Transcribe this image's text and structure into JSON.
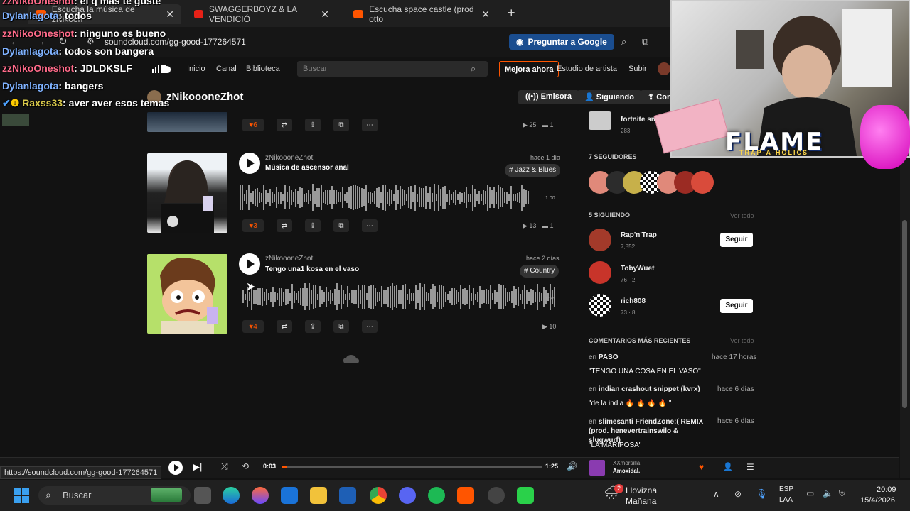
{
  "browser": {
    "tabs": [
      {
        "label": "Escucha la música de zNikoon"
      },
      {
        "label": "SWAGGERBOYZ & LA VENDICIÓ"
      },
      {
        "label": "Escucha space castle (prod otto"
      }
    ],
    "new_tab": "+",
    "url": "soundcloud.com/gg-good-177264571",
    "google_button": "Preguntar a Google"
  },
  "soundcloud": {
    "nav": {
      "home": "Inicio",
      "feed": "Canal",
      "library": "Biblioteca"
    },
    "search_placeholder": "Buscar",
    "upgrade": "Mejora ahora",
    "artist_studio": "Estudio de artista",
    "upload": "Subir",
    "profile_name": "zNikoooneZhot",
    "buttons": {
      "station": "Emisora",
      "following": "Siguiendo",
      "share": "Com"
    },
    "tracks": [
      {
        "likes": "6",
        "plays": "25",
        "comments": "1"
      },
      {
        "user": "zNikoooneZhot",
        "title": "Música de ascensor anal",
        "date": "hace 1 día",
        "tag": "# Jazz & Blues",
        "duration": "1:00",
        "likes": "3",
        "plays": "13",
        "comments": "1"
      },
      {
        "user": "zNikoooneZhot",
        "title": "Tengo una1 kosa en el vaso",
        "date": "hace 2 días",
        "tag": "# Country",
        "duration": "1:25",
        "likes": "4",
        "plays": "10"
      }
    ],
    "sidebar": {
      "top_user": {
        "name": "fortnite snip",
        "stats": "283"
      },
      "followers_title": "7 SEGUIDORES",
      "following_title": "5 SIGUIENDO",
      "view_all": "Ver todo",
      "following": [
        {
          "name": "Rap'n'Trap",
          "stats": "7,852",
          "button": "Seguir"
        },
        {
          "name": "TobyWuet",
          "stats": "76 · 2"
        },
        {
          "name": "rich808",
          "stats": "73 · 8",
          "button": "Seguir"
        }
      ],
      "comments_title": "COMENTARIOS MÁS RECIENTES",
      "comments": [
        {
          "prefix": "en",
          "track": "PASO",
          "time": "hace 17 horas",
          "text": "\"TENGO UNA COSA EN EL VASO\""
        },
        {
          "prefix": "en",
          "track": "indian crashout snippet (kvrx)",
          "time": "hace 6 días",
          "text": "\"de la india 🔥 🔥 🔥 🔥 \""
        },
        {
          "prefix": "en",
          "track": "slimesanti FriendZone:( REMIX (prod. henevertrainswilo & slugwurf)",
          "time": "hace 6 días",
          "text": "\"LA MARIPOSA\""
        }
      ]
    },
    "player": {
      "time_current": "0:03",
      "time_total": "1:25",
      "artist": "XXmorsilla",
      "track": "Amoxidal.",
      "progress": 0.02
    }
  },
  "status_url": "https://soundcloud.com/gg-good-177264571",
  "chat": [
    {
      "user": "zzNikoOneshot",
      "msg": ": el q mas te guste"
    },
    {
      "user": "Dylanlagota",
      "msg": ": todos"
    },
    {
      "user": "zzNikoOneshot",
      "msg": ": ninguno es bueno"
    },
    {
      "user": "Dylanlagota",
      "msg": ": todos son bangera"
    },
    {
      "user": "zzNikoOneshot",
      "msg": ": JDLDKSLF"
    },
    {
      "user": "Dylanlagota",
      "msg": ": bangers"
    },
    {
      "user": "Raxss33",
      "msg": ": aver aver esos temas"
    }
  ],
  "overlay": {
    "title": "FLAME",
    "subtitle": "TRAP-A-HOLICS"
  },
  "taskbar": {
    "search": "Buscar",
    "weather_temp": "2",
    "weather_text": "Lloviznа",
    "weather_sub": "Mañana",
    "lang": "ESP",
    "lang_sub": "LAA",
    "time": "20:09",
    "date": "15/4/2026"
  },
  "colors": {
    "accent": "#ff5500",
    "background": "#121212"
  }
}
